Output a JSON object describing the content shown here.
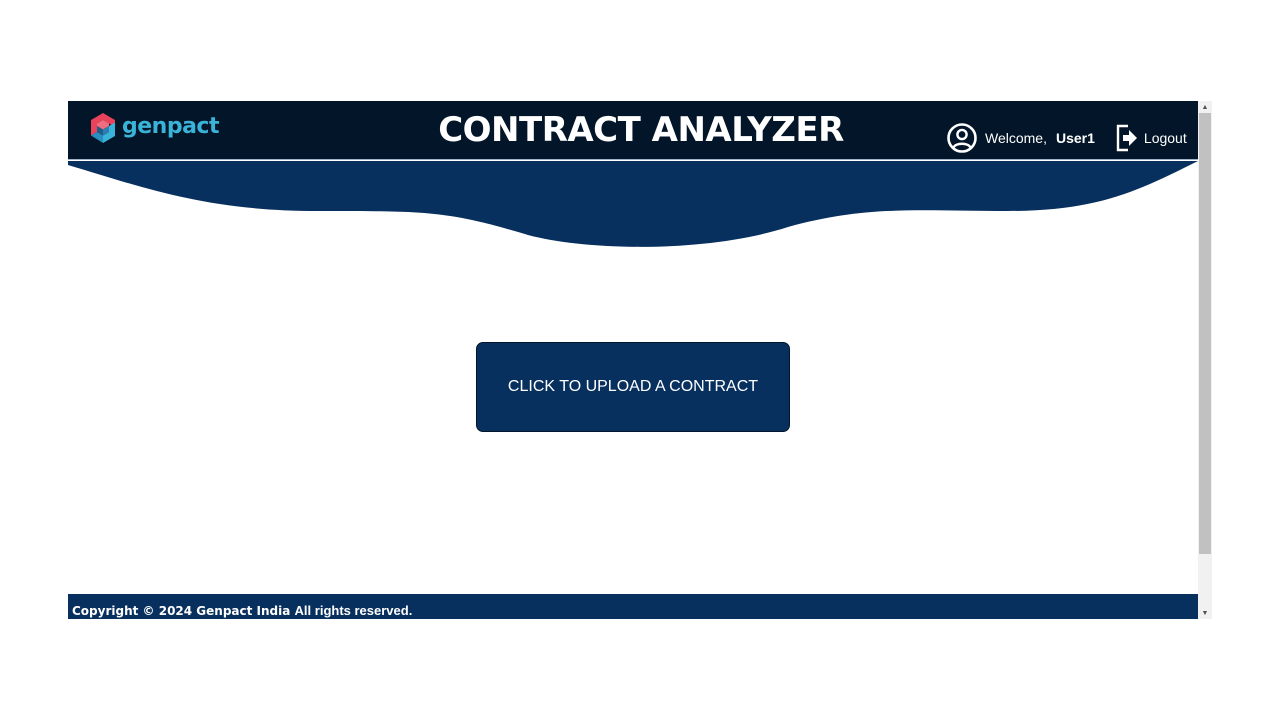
{
  "brand": {
    "logo_text": "genpact",
    "icon": "genpact-logo-icon"
  },
  "header": {
    "title": "CONTRACT ANALYZER",
    "welcome_label": "Welcome,",
    "username": "User1",
    "user_icon": "user-circle-icon",
    "logout_label": "Logout",
    "logout_icon": "logout-icon"
  },
  "main": {
    "upload_label": "CLICK TO UPLOAD A CONTRACT"
  },
  "footer": {
    "copyright": "Copyright © 2024 Genpact India",
    "rights": "All rights reserved."
  },
  "colors": {
    "header_bg": "#031528",
    "brand_navy": "#08305f",
    "logo_teal": "#3ab3d8",
    "logo_red": "#e8435a",
    "scrollbar_thumb": "#c1c1c1"
  }
}
